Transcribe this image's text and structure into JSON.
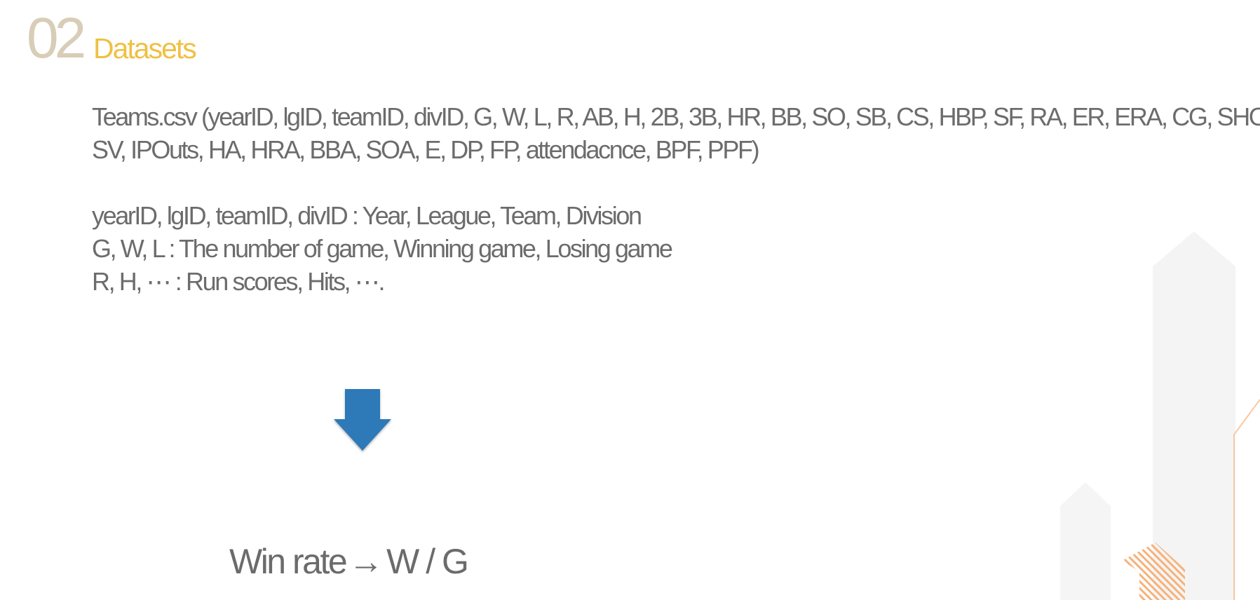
{
  "header": {
    "section_number": "02",
    "section_title": "Datasets"
  },
  "schema": {
    "line1": "Teams.csv (yearID, lgID, teamID, divID, G, W, L, R, AB, H, 2B, 3B, HR, BB, SO, SB, CS, HBP, SF, RA, ER, ERA, CG, SHO,",
    "line2": "SV, IPOuts, HA, HRA, BBA, SOA, E, DP, FP, attendacnce, BPF, PPF)"
  },
  "descriptions": [
    "yearID, lgID, teamID, divID : Year, League, Team, Division",
    "G, W, L : The number of game, Winning game, Losing game",
    "R, H, ⋯ : Run scores, Hits, ⋯."
  ],
  "formula": {
    "label": "Win rate",
    "arrow": "→",
    "expression": "W / G"
  },
  "colors": {
    "section_number": "#d8cdb6",
    "section_title": "#efc043",
    "body_text": "#6c6c6c",
    "arrow_fill": "#2f79b8",
    "deco_orange": "#f6b27a",
    "deco_gray": "#f3f3f3"
  },
  "icons": {
    "down_arrow": "down-arrow-icon"
  }
}
